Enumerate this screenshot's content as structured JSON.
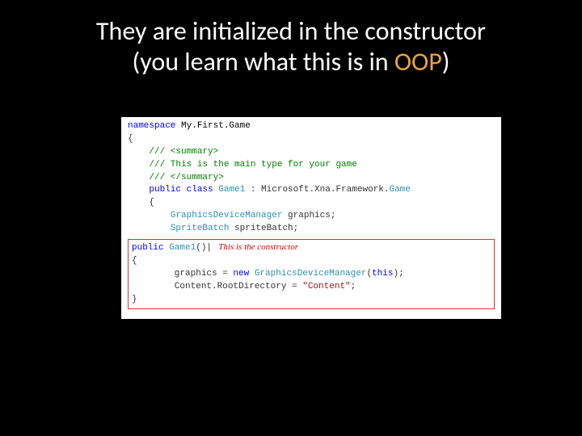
{
  "title": {
    "line1": "They are initialized in the constructor",
    "line2_prefix": "(you learn what this is in ",
    "line2_oop": "OOP",
    "line2_suffix": ")"
  },
  "code": {
    "kw_namespace": "namespace",
    "ns_name": " My.First.Game",
    "open_brace": "{",
    "c1": "    /// <summary>",
    "c2": "    /// This is the main type for your game",
    "c3": "    /// </summary>",
    "pub": "    public",
    "cls": " class",
    "clsname": " Game1 ",
    "inherit": ": Microsoft.Xna.Framework.",
    "basecls": "Game",
    "open_brace2": "    {",
    "fld1_type": "        GraphicsDeviceManager ",
    "fld1_name": "graphics;",
    "fld2_type": "        SpriteBatch ",
    "fld2_name": "spriteBatch;",
    "ctor_pub": "public",
    "ctor_name": " Game1",
    "ctor_parens": "()",
    "cursor": "|",
    "ctor_note": "   This is the constructor",
    "ctor_open": "{",
    "line_a_pre": "        graphics = ",
    "line_a_new": "new",
    "line_a_type": " GraphicsDeviceManager",
    "line_a_post": "(",
    "line_a_this": "this",
    "line_a_end": ");",
    "line_b_pre": "        Content.RootDirectory = ",
    "line_b_str": "\"Content\"",
    "line_b_end": ";",
    "ctor_close": "}"
  }
}
